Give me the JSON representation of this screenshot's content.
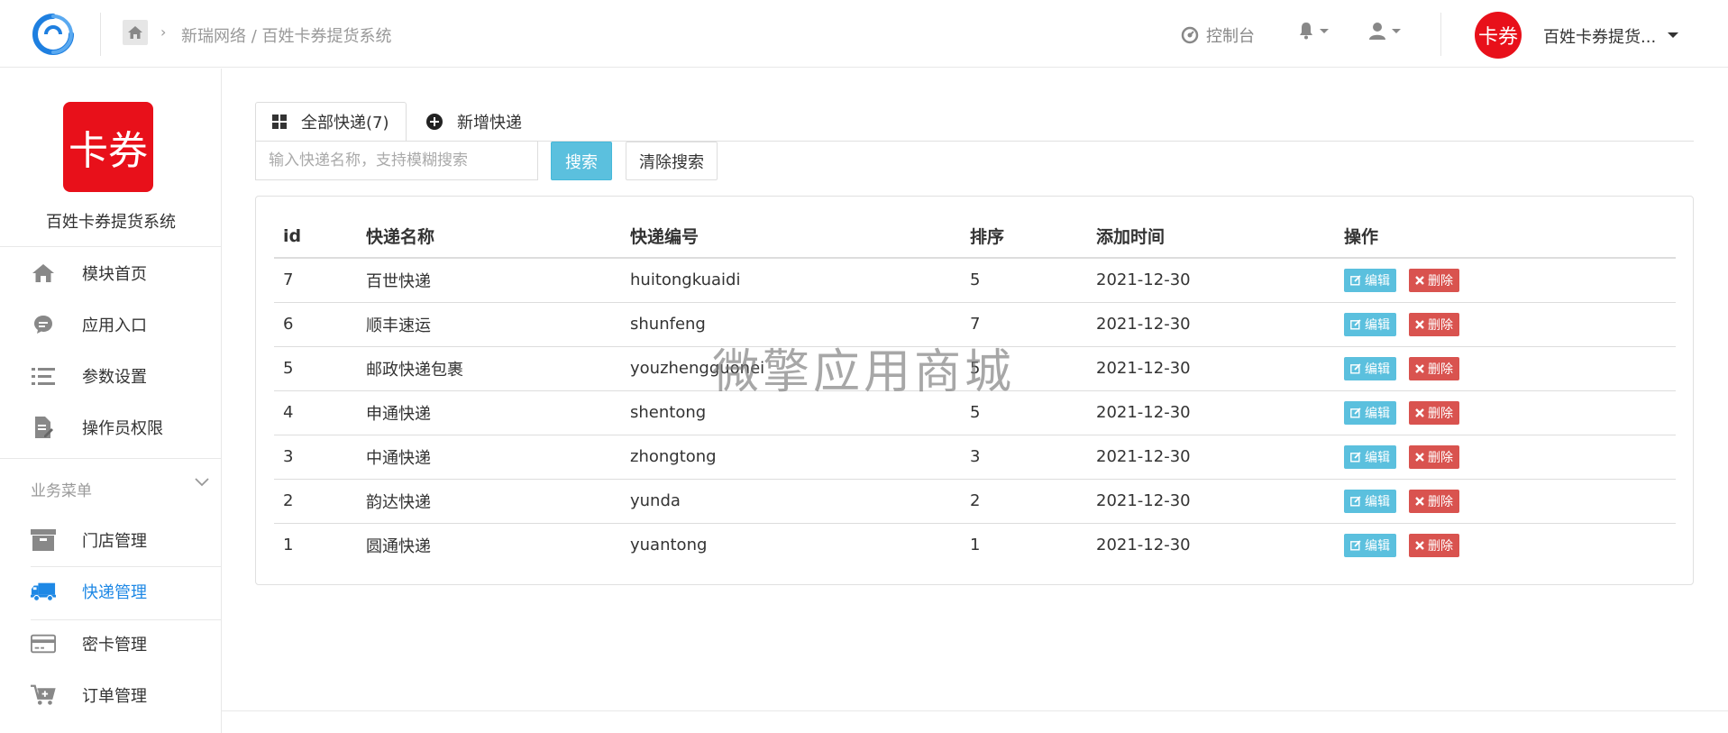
{
  "header": {
    "breadcrumb": "新瑞网络 / 百姓卡券提货系统",
    "console_label": "控制台",
    "avatar_text": "卡券",
    "user_name": "百姓卡券提货..."
  },
  "sidebar": {
    "brand_logo_text": "卡券",
    "brand_name": "百姓卡券提货系统",
    "items": [
      {
        "label": "模块首页",
        "icon": "home-icon"
      },
      {
        "label": "应用入口",
        "icon": "chat-bubble-icon"
      },
      {
        "label": "参数设置",
        "icon": "list-settings-icon"
      },
      {
        "label": "操作员权限",
        "icon": "file-edit-icon"
      }
    ],
    "section_title": "业务菜单",
    "business_items": [
      {
        "label": "门店管理",
        "icon": "archive-box-icon"
      },
      {
        "label": "快递管理",
        "icon": "truck-icon"
      },
      {
        "label": "密卡管理",
        "icon": "credit-card-icon"
      },
      {
        "label": "订单管理",
        "icon": "cart-icon"
      }
    ]
  },
  "tabs": [
    {
      "label": "全部快递(7)",
      "icon": "grid-icon"
    },
    {
      "label": "新增快递",
      "icon": "plus-circle-icon"
    }
  ],
  "search": {
    "placeholder": "输入快递名称，支持模糊搜索",
    "search_label": "搜索",
    "clear_label": "清除搜索"
  },
  "table": {
    "columns": [
      "id",
      "快递名称",
      "快递编号",
      "排序",
      "添加时间",
      "操作"
    ],
    "rows": [
      {
        "id": "7",
        "name": "百世快递",
        "code": "huitongkuaidi",
        "sort": "5",
        "date": "2021-12-30"
      },
      {
        "id": "6",
        "name": "顺丰速运",
        "code": "shunfeng",
        "sort": "7",
        "date": "2021-12-30"
      },
      {
        "id": "5",
        "name": "邮政快递包裹",
        "code": "youzhengguonei",
        "sort": "5",
        "date": "2021-12-30"
      },
      {
        "id": "4",
        "name": "申通快递",
        "code": "shentong",
        "sort": "5",
        "date": "2021-12-30"
      },
      {
        "id": "3",
        "name": "中通快递",
        "code": "zhongtong",
        "sort": "3",
        "date": "2021-12-30"
      },
      {
        "id": "2",
        "name": "韵达快递",
        "code": "yunda",
        "sort": "2",
        "date": "2021-12-30"
      },
      {
        "id": "1",
        "name": "圆通快递",
        "code": "yuantong",
        "sort": "1",
        "date": "2021-12-30"
      }
    ],
    "edit_label": "编辑",
    "delete_label": "删除"
  },
  "watermark": "微擎应用商城",
  "colors": {
    "brand_red": "#e8101a",
    "accent_blue": "#1e88e5",
    "info": "#5bc0de",
    "danger": "#d9534f"
  }
}
